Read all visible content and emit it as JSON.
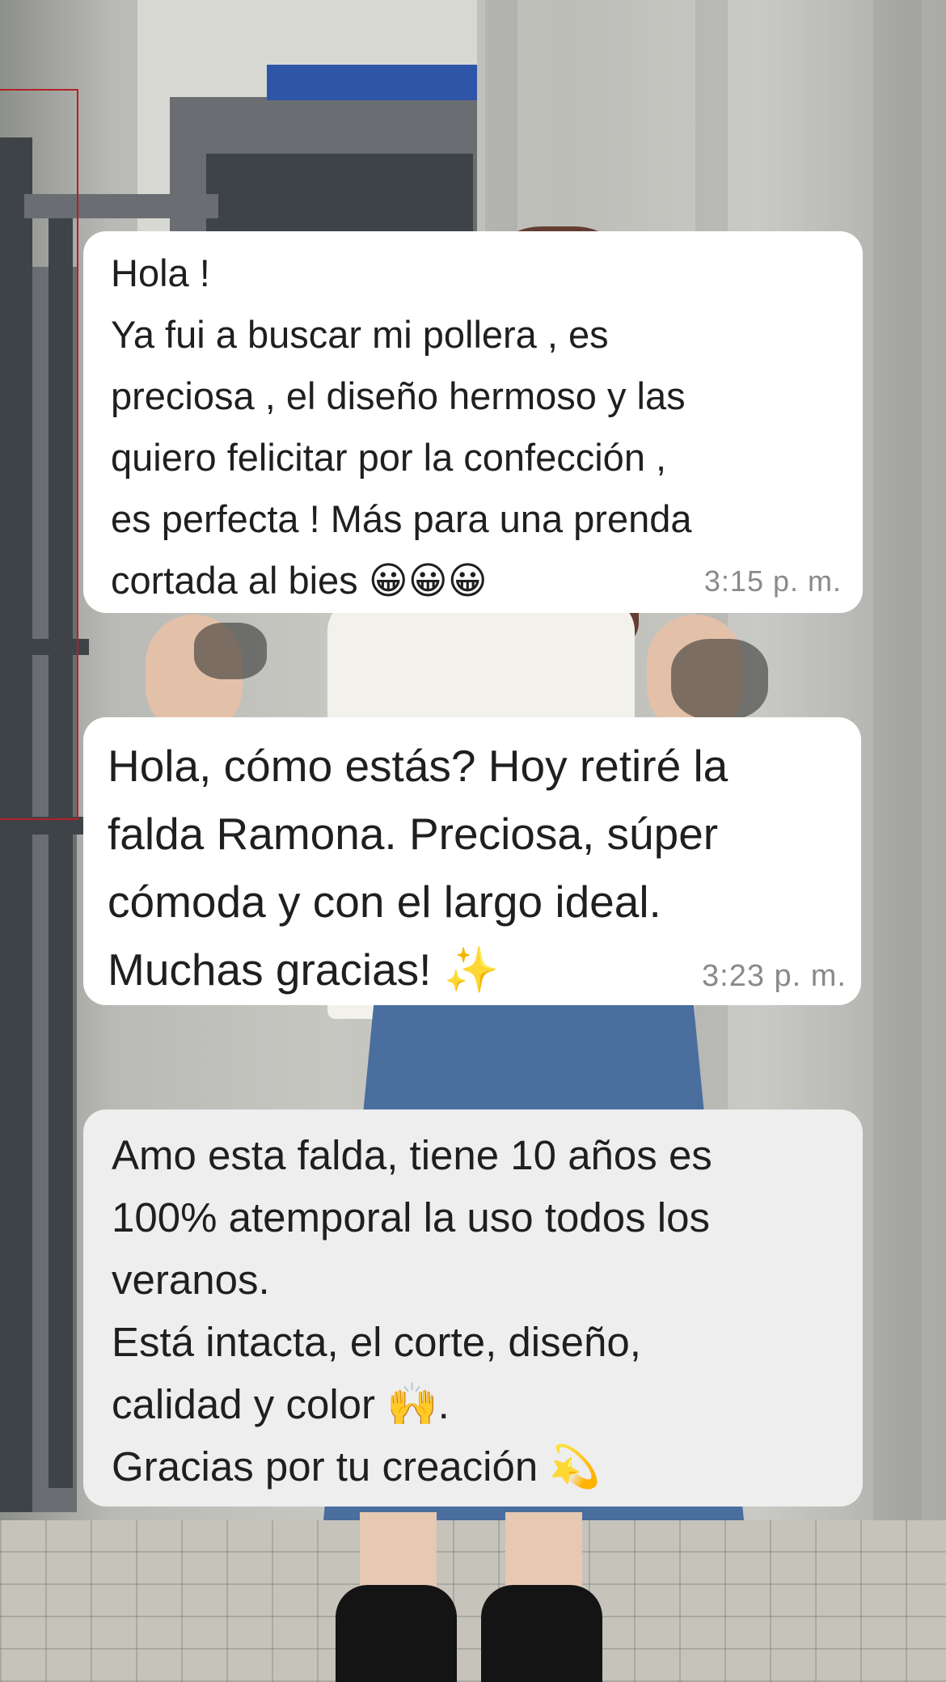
{
  "messages": [
    {
      "text": "Hola !\nYa fui a buscar mi pollera , es\npreciosa , el diseño hermoso y las\nquiero felicitar por la confección ,\nes perfecta ! Más para una prenda\ncortada al bies 😀😀😀",
      "time": "3:15 p. m."
    },
    {
      "text": "Hola, cómo estás? Hoy retiré la\nfalda Ramona. Preciosa, súper\ncómoda y con el largo ideal.\nMuchas gracias! ✨",
      "time": "3:23 p. m."
    },
    {
      "text": "Amo esta falda, tiene 10 años es\n100% atemporal la uso todos los\nveranos.\nEstá intacta, el corte, diseño,\ncalidad y color 🙌.\nGracias por tu creación 💫"
    }
  ]
}
